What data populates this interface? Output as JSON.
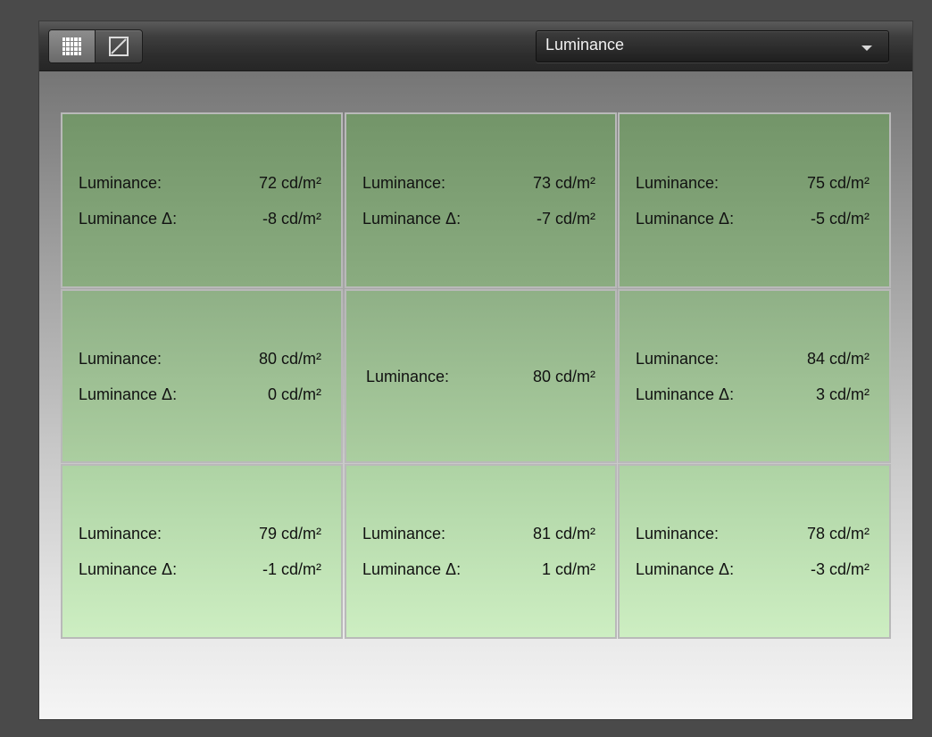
{
  "toolbar": {
    "view_grid_icon": "grid-icon",
    "view_curve_icon": "curve-icon",
    "dropdown_selected": "Luminance"
  },
  "cells": [
    {
      "label1": "Luminance:",
      "value1": "72 cd/m²",
      "label2": "Luminance Δ:",
      "value2": "-8 cd/m²"
    },
    {
      "label1": "Luminance:",
      "value1": "73 cd/m²",
      "label2": "Luminance Δ:",
      "value2": "-7 cd/m²"
    },
    {
      "label1": "Luminance:",
      "value1": "75 cd/m²",
      "label2": "Luminance Δ:",
      "value2": "-5 cd/m²"
    },
    {
      "label1": "Luminance:",
      "value1": "80 cd/m²",
      "label2": "Luminance Δ:",
      "value2": "0 cd/m²"
    },
    {
      "label1": "Luminance:",
      "value1": "80 cd/m²"
    },
    {
      "label1": "Luminance:",
      "value1": "84 cd/m²",
      "label2": "Luminance Δ:",
      "value2": "3 cd/m²"
    },
    {
      "label1": "Luminance:",
      "value1": "79 cd/m²",
      "label2": "Luminance Δ:",
      "value2": "-1 cd/m²"
    },
    {
      "label1": "Luminance:",
      "value1": "81 cd/m²",
      "label2": "Luminance Δ:",
      "value2": "1 cd/m²"
    },
    {
      "label1": "Luminance:",
      "value1": "78 cd/m²",
      "label2": "Luminance Δ:",
      "value2": "-3 cd/m²"
    }
  ],
  "colors": {
    "row_top_start": "#739569",
    "row_top_end": "#8aac80",
    "row_mid_start": "#8fb086",
    "row_mid_end": "#abcea0",
    "row_bot_start": "#aed3a4",
    "row_bot_end": "#cdeec2"
  }
}
